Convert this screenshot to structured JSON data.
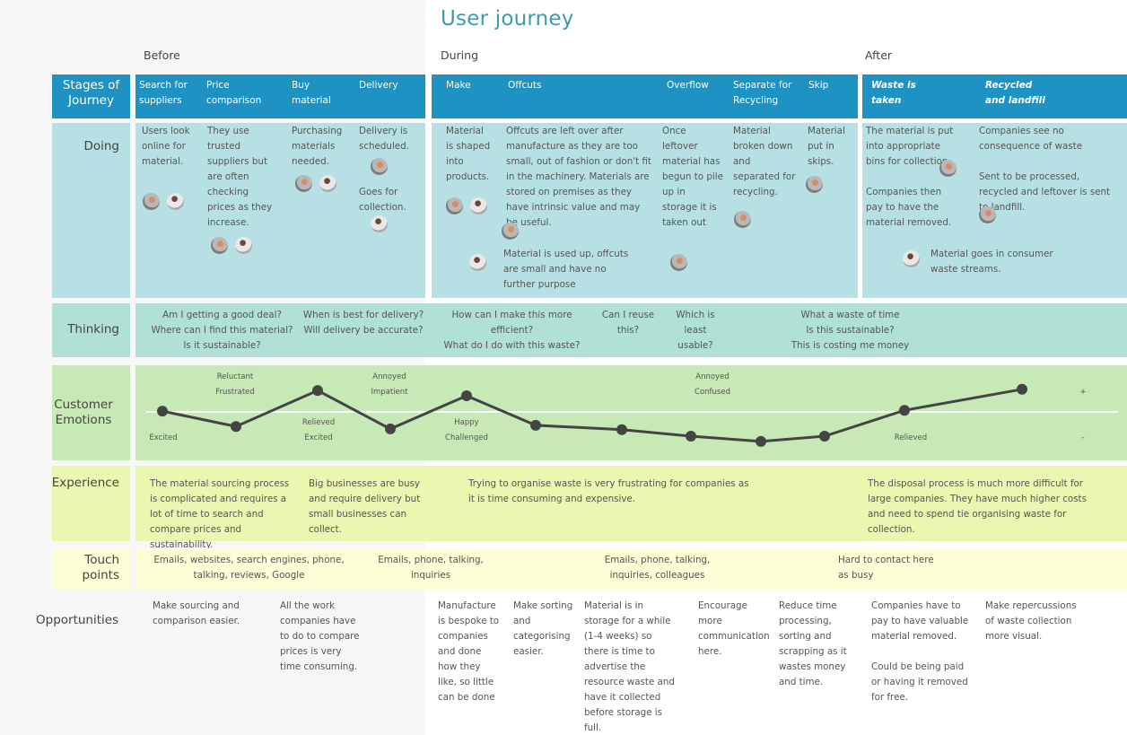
{
  "title": "User journey",
  "phases": {
    "before": "Before",
    "during": "During",
    "after": "After"
  },
  "row_labels": {
    "stages": "Stages of Journey",
    "doing": "Doing",
    "thinking": "Thinking",
    "emotions": "Customer Emotions",
    "experience": "Experience",
    "touchpoints": "Touch points",
    "opportunities": "Opportunities"
  },
  "stages": [
    {
      "label": "Search for suppliers",
      "phase": "before"
    },
    {
      "label": "Price comparison",
      "phase": "before"
    },
    {
      "label": "Buy material",
      "phase": "before"
    },
    {
      "label": "Delivery",
      "phase": "before"
    },
    {
      "label": "Make",
      "phase": "during"
    },
    {
      "label": "Offcuts",
      "phase": "during"
    },
    {
      "label": "Overflow",
      "phase": "during"
    },
    {
      "label": "Separate for Recycling",
      "phase": "during"
    },
    {
      "label": "Skip",
      "phase": "during"
    },
    {
      "label": "Waste is taken",
      "phase": "after"
    },
    {
      "label": "Recycled and landfill",
      "phase": "after"
    }
  ],
  "doing": [
    {
      "text": "Users look online for material."
    },
    {
      "text": "They use trusted suppliers but are often checking prices as they increase."
    },
    {
      "text": "Purchasing materials needed."
    },
    {
      "text": "Delivery is scheduled."
    },
    {
      "text": "Goes for collection."
    },
    {
      "text": "Material is shaped into products."
    },
    {
      "text": "Offcuts are left over after manufacture as they are too small, out of fashion or don't fit in the machinery. Materials are stored on premises as they have intrinsic value and may be useful."
    },
    {
      "text": "Material is used up, offcuts are small and have no further purpose"
    },
    {
      "text": "Once leftover material has begun to pile up in storage it is taken out"
    },
    {
      "text": "Material broken down and separated for recycling."
    },
    {
      "text": "Material put in skips."
    },
    {
      "text": "The material is put into appropriate bins for collection."
    },
    {
      "text": "Companies then pay to have the material removed."
    },
    {
      "text": "Companies see no consequence of waste"
    },
    {
      "text": "Sent to be processed, recycled and leftover is sent to landfill."
    },
    {
      "text": "Material goes in consumer waste streams."
    }
  ],
  "thinking": [
    {
      "text": "Am I getting a good deal?\nWhere can I find this material?\nIs it sustainable?"
    },
    {
      "text": "When is best for delivery?\nWill delivery be accurate?"
    },
    {
      "text": "How can I make this more\nefficient?\nWhat do I do with this waste?"
    },
    {
      "text": "Can I reuse\nthis?"
    },
    {
      "text": "Which is\nleast\nusable?"
    },
    {
      "text": "What a waste of time\nIs this sustainable?\nThis is costing me money"
    }
  ],
  "emotions": {
    "scale_top": "+",
    "scale_bottom": "-",
    "points": [
      0.02,
      -0.36,
      0.53,
      -0.42,
      0.4,
      -0.33,
      -0.44,
      -0.6,
      -0.73,
      -0.6,
      0.04,
      0.56
    ],
    "labels": [
      {
        "text": "Excited"
      },
      {
        "text": "Reluctant\nFrustrated"
      },
      {
        "text": "Relieved\nExcited"
      },
      {
        "text": "Annoyed\nImpatient"
      },
      {
        "text": "Happy\nChallenged"
      },
      {
        "text": "Annoyed\nConfused"
      },
      {
        "text": "Relieved"
      }
    ]
  },
  "experience": [
    {
      "text": "The material sourcing process is complicated and requires a lot of time to search and compare prices and sustainability."
    },
    {
      "text": "Big businesses are busy and require delivery but small businesses can collect."
    },
    {
      "text": "Trying to organise waste is very frustrating for companies as it is time consuming and expensive."
    },
    {
      "text": "The disposal process is much more difficult for large companies. They have much higher costs and need to spend tie organising waste for collection."
    }
  ],
  "touchpoints": [
    {
      "text": "Emails, websites, search engines, phone,\ntalking, reviews, Google"
    },
    {
      "text": "Emails, phone, talking,\ninquiries"
    },
    {
      "text": "Emails, phone, talking,\ninquiries, colleagues"
    },
    {
      "text": "Hard to contact here\nas busy"
    }
  ],
  "opportunities": [
    {
      "text": "Make sourcing and comparison easier."
    },
    {
      "text": "All the work companies have to do to compare prices is very time consuming."
    },
    {
      "text": "Manufacture is bespoke to companies and done how they like, so little can be done"
    },
    {
      "text": "Make sorting and categorising easier."
    },
    {
      "text": "Material is in storage for a while (1-4 weeks) so there is time to advertise the resource waste and have it collected before storage is full."
    },
    {
      "text": "Encourage more communication here."
    },
    {
      "text": "Reduce time processing, sorting and scrapping as it wastes money and time."
    },
    {
      "text": "Companies have to pay to have valuable material removed.\n\nCould be being paid or having it removed for free."
    },
    {
      "text": "Make repercussions of waste collection more visual."
    }
  ],
  "colors": {
    "stage_bar": "#1e92c2",
    "doing": "#b7e0e4",
    "thinking": "#b1e0d6",
    "emotions": "#c7e9b5",
    "experience": "#eaf7b0",
    "touchpoints": "#fdfdd6",
    "title": "#3a9bb0",
    "emotion_line": "#444444"
  }
}
